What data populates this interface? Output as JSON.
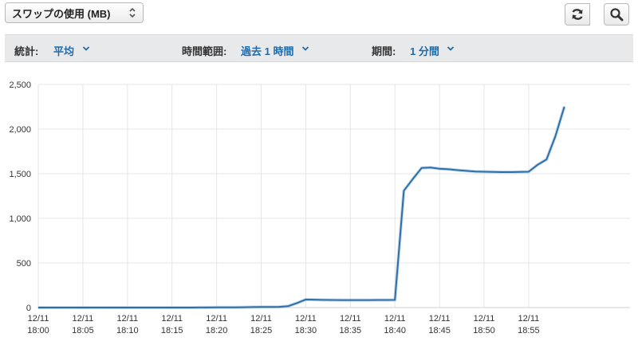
{
  "toolbar": {
    "metric_label": "スワップの使用 (MB)",
    "refresh_icon": "refresh-icon",
    "zoom_icon": "zoom-icon"
  },
  "filters": {
    "stat_label": "統計:",
    "stat_value": "平均",
    "range_label": "時間範囲:",
    "range_value": "過去 1 時間",
    "period_label": "期間:",
    "period_value": "1 分間"
  },
  "colors": {
    "line": "#2e6fa7",
    "accent": "#1f6aa8",
    "grid": "#e5e5e5"
  },
  "chart_data": {
    "type": "line",
    "title": "",
    "xlabel": "",
    "ylabel": "",
    "ylim": [
      0,
      2500
    ],
    "yticks": [
      "2,500",
      "2,000",
      "1,500",
      "1,000",
      "500",
      "0"
    ],
    "ytick_values": [
      2500,
      2000,
      1500,
      1000,
      500,
      0
    ],
    "xticks": [
      [
        "12/11",
        "18:00"
      ],
      [
        "12/11",
        "18:05"
      ],
      [
        "12/11",
        "18:10"
      ],
      [
        "12/11",
        "18:15"
      ],
      [
        "12/11",
        "18:20"
      ],
      [
        "12/11",
        "18:25"
      ],
      [
        "12/11",
        "18:30"
      ],
      [
        "12/11",
        "18:35"
      ],
      [
        "12/11",
        "18:40"
      ],
      [
        "12/11",
        "18:45"
      ],
      [
        "12/11",
        "18:50"
      ],
      [
        "12/11",
        "18:55"
      ]
    ],
    "x": [
      "18:00",
      "18:01",
      "18:02",
      "18:03",
      "18:04",
      "18:05",
      "18:06",
      "18:07",
      "18:08",
      "18:09",
      "18:10",
      "18:11",
      "18:12",
      "18:13",
      "18:14",
      "18:15",
      "18:16",
      "18:17",
      "18:18",
      "18:19",
      "18:20",
      "18:21",
      "18:22",
      "18:23",
      "18:24",
      "18:25",
      "18:26",
      "18:27",
      "18:28",
      "18:29",
      "18:30",
      "18:31",
      "18:32",
      "18:33",
      "18:34",
      "18:35",
      "18:36",
      "18:37",
      "18:38",
      "18:39",
      "18:40",
      "18:41",
      "18:42",
      "18:43",
      "18:44",
      "18:45",
      "18:46",
      "18:47",
      "18:48",
      "18:49",
      "18:50",
      "18:51",
      "18:52",
      "18:53",
      "18:54",
      "18:55",
      "18:56",
      "18:57",
      "18:58",
      "18:59"
    ],
    "series": [
      {
        "values": [
          0,
          0,
          0,
          0,
          0,
          0,
          0,
          0,
          0,
          0,
          0,
          0,
          0,
          0,
          0,
          0,
          0,
          0,
          1,
          1,
          2,
          2,
          3,
          4,
          5,
          6,
          7,
          8,
          15,
          50,
          90,
          88,
          86,
          85,
          84,
          84,
          84,
          84,
          85,
          85,
          86,
          1310,
          1440,
          1565,
          1570,
          1555,
          1550,
          1540,
          1532,
          1525,
          1522,
          1520,
          1518,
          1518,
          1520,
          1522,
          1600,
          1660,
          1920,
          2250
        ]
      }
    ]
  }
}
